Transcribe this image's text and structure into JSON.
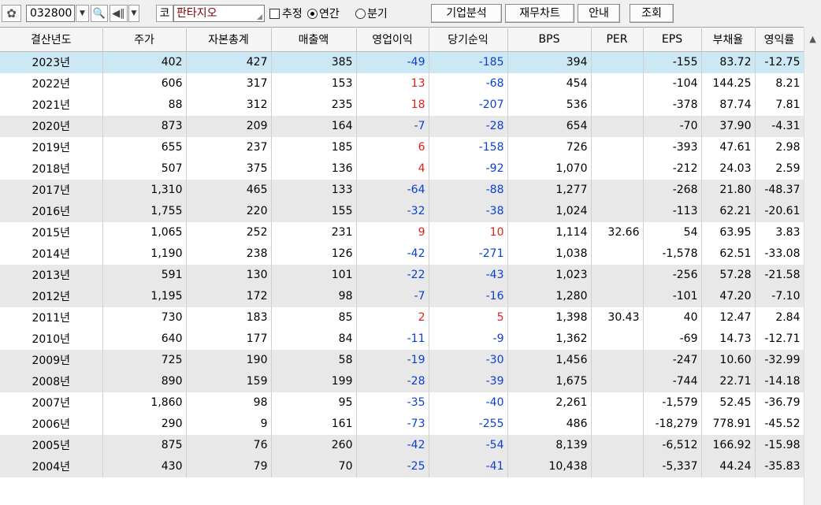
{
  "toolbar": {
    "stock_code": "032800",
    "market": "코",
    "company": "판타지오",
    "estimate_label": "추정",
    "annual_label": "연간",
    "quarter_label": "분기",
    "buttons": [
      "기업분석",
      "재무차트",
      "안내",
      "조회"
    ]
  },
  "columns": [
    "결산년도",
    "주가",
    "자본총계",
    "매출액",
    "영업이익",
    "당기순익",
    "BPS",
    "PER",
    "EPS",
    "부채율",
    "영익률"
  ],
  "rows": [
    [
      "2023년",
      "402",
      "427",
      "385",
      "-49",
      "-185",
      "394",
      "",
      "-155",
      "83.72",
      "-12.75"
    ],
    [
      "2022년",
      "606",
      "317",
      "153",
      "13",
      "-68",
      "454",
      "",
      "-104",
      "144.25",
      "8.21"
    ],
    [
      "2021년",
      "88",
      "312",
      "235",
      "18",
      "-207",
      "536",
      "",
      "-378",
      "87.74",
      "7.81"
    ],
    [
      "2020년",
      "873",
      "209",
      "164",
      "-7",
      "-28",
      "654",
      "",
      "-70",
      "37.90",
      "-4.31"
    ],
    [
      "2019년",
      "655",
      "237",
      "185",
      "6",
      "-158",
      "726",
      "",
      "-393",
      "47.61",
      "2.98"
    ],
    [
      "2018년",
      "507",
      "375",
      "136",
      "4",
      "-92",
      "1,070",
      "",
      "-212",
      "24.03",
      "2.59"
    ],
    [
      "2017년",
      "1,310",
      "465",
      "133",
      "-64",
      "-88",
      "1,277",
      "",
      "-268",
      "21.80",
      "-48.37"
    ],
    [
      "2016년",
      "1,755",
      "220",
      "155",
      "-32",
      "-38",
      "1,024",
      "",
      "-113",
      "62.21",
      "-20.61"
    ],
    [
      "2015년",
      "1,065",
      "252",
      "231",
      "9",
      "10",
      "1,114",
      "32.66",
      "54",
      "63.95",
      "3.83"
    ],
    [
      "2014년",
      "1,190",
      "238",
      "126",
      "-42",
      "-271",
      "1,038",
      "",
      "-1,578",
      "62.51",
      "-33.08"
    ],
    [
      "2013년",
      "591",
      "130",
      "101",
      "-22",
      "-43",
      "1,023",
      "",
      "-256",
      "57.28",
      "-21.58"
    ],
    [
      "2012년",
      "1,195",
      "172",
      "98",
      "-7",
      "-16",
      "1,280",
      "",
      "-101",
      "47.20",
      "-7.10"
    ],
    [
      "2011년",
      "730",
      "183",
      "85",
      "2",
      "5",
      "1,398",
      "30.43",
      "40",
      "12.47",
      "2.84"
    ],
    [
      "2010년",
      "640",
      "177",
      "84",
      "-11",
      "-9",
      "1,362",
      "",
      "-69",
      "14.73",
      "-12.71"
    ],
    [
      "2009년",
      "725",
      "190",
      "58",
      "-19",
      "-30",
      "1,456",
      "",
      "-247",
      "10.60",
      "-32.99"
    ],
    [
      "2008년",
      "890",
      "159",
      "199",
      "-28",
      "-39",
      "1,675",
      "",
      "-744",
      "22.71",
      "-14.18"
    ],
    [
      "2007년",
      "1,860",
      "98",
      "95",
      "-35",
      "-40",
      "2,261",
      "",
      "-1,579",
      "52.45",
      "-36.79"
    ],
    [
      "2006년",
      "290",
      "9",
      "161",
      "-73",
      "-255",
      "486",
      "",
      "-18,279",
      "778.91",
      "-45.52"
    ],
    [
      "2005년",
      "875",
      "76",
      "260",
      "-42",
      "-54",
      "8,139",
      "",
      "-6,512",
      "166.92",
      "-15.98"
    ],
    [
      "2004년",
      "430",
      "79",
      "70",
      "-25",
      "-41",
      "10,438",
      "",
      "-5,337",
      "44.24",
      "-35.83"
    ]
  ],
  "colors": {
    "negative": "#0b3fd6",
    "positive": "#e0201a",
    "selected_row": "#cce8f4",
    "company_name": "#800000"
  }
}
